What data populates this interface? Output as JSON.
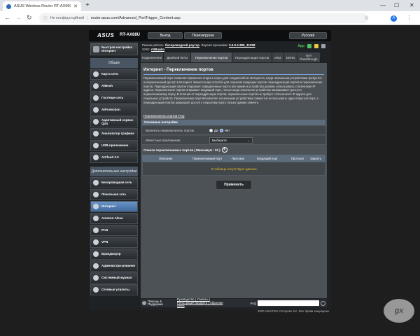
{
  "browser": {
    "tab_title": "ASUS Wireless Router RT-AX68U",
    "not_secure": "Не конфіденційний",
    "url": "router.asus.com/Advanced_PortTrigger_Content.asp",
    "avatar_letter": "A"
  },
  "router": {
    "logo": "ASUS",
    "model": "RT-AX68U",
    "logout": "Выход",
    "reboot": "Перезагрузка",
    "language": "Русский",
    "status_row1_label": "Режим работы:",
    "status_row1_value": "беспроводной роутер",
    "status_row1_fw_label": "Версия прошивки:",
    "status_row1_fw_value": "3.0.0.4.386_41098",
    "status_row2_label": "SSID:",
    "status_row2_value": "rt68uabo",
    "app_label": "App"
  },
  "sidebar": {
    "quick_setup": "Быстрая настройка Интернет",
    "general_header": "Общие",
    "general_items": [
      "Карта сети",
      "AiMesh",
      "Гостевая сеть",
      "AiProtection",
      "Адаптивный сервис QoS",
      "Анализатор трафика",
      "USB-приложение",
      "AiCloud 2.0"
    ],
    "advanced_header": "Дополнительные настройки",
    "advanced_items": [
      "Беспроводная сеть",
      "Локальная сеть",
      "Интернет",
      "Amazon Alexa",
      "IPv6",
      "VPN",
      "Брандмауэр",
      "Администри-рование",
      "Системный журнал",
      "Сетевые утилиты"
    ]
  },
  "tabs": [
    "Подключение",
    "Двойной WAN",
    "Переключение портов",
    "Переадресация портов",
    "DMZ",
    "DDNS",
    "NAT Passthrough"
  ],
  "panel": {
    "title": "Интернет - Переключение портов",
    "description": "Переключаемый порт позволяет временно открыть порты для соединений из Интернета, когда локальным устройствам требуется неограниченный доступ в Интернет. Имеются два способа для открытия входящих портов: переадресация портов и переключение портов. Переадресация портов открывает определенные порты все время и устройства должны использовать статические IP адреса. Переключение портов открывает входящий порт, только когда локальное устройство запрашивает доступ к переключаемому порту. В отличии от переадресации портов, переключение портов не требует статического IP адреса для локальных устройств. Переключение портовпозволяет нескольким устройствам совместно использовать один открытый порт, а переадресация портов разрешает доступ к открытому порту только одному клиенту.",
    "faq_link": "Переключатель портов  FAQ",
    "basic_header": "Основные настройки",
    "enable_label": "Включить переключатель портов",
    "radio_yes": "Да",
    "radio_no": "Нет",
    "known_apps_label": "Известные приложения",
    "known_apps_value": "Выберите",
    "list_header": "Список переключаемых портов ( Максимум : 32 )",
    "columns": [
      "Описание",
      "Переключаемый порт",
      "Протокол",
      "Входящий порт",
      "Протокол",
      "Удалить"
    ],
    "no_data": "В таблице отсутствуют данные.",
    "apply": "Применить"
  },
  "footer": {
    "help": "Помощь & Поддержка",
    "links": "Руководство | Утилиты | Регистрация продукта | Обратная связь",
    "faq": "FAQ",
    "copyright": "2020 ASUSTeK Computer Inc. Все права защищены."
  }
}
